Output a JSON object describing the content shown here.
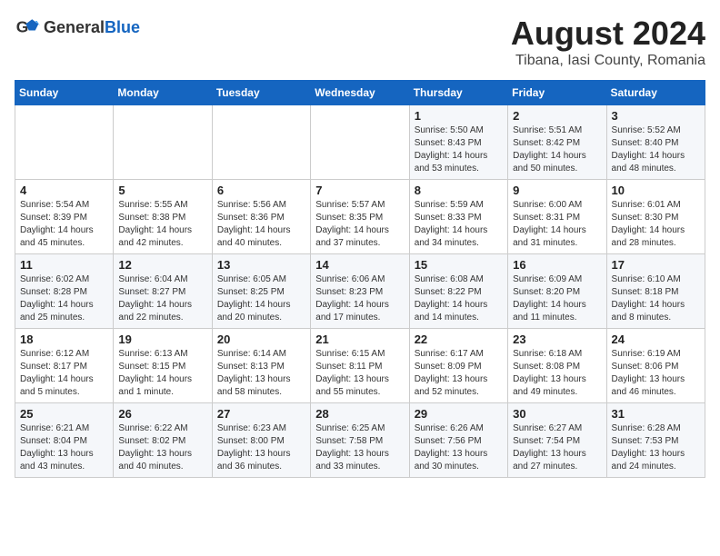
{
  "logo": {
    "text_general": "General",
    "text_blue": "Blue"
  },
  "title": "August 2024",
  "subtitle": "Tibana, Iasi County, Romania",
  "days_of_week": [
    "Sunday",
    "Monday",
    "Tuesday",
    "Wednesday",
    "Thursday",
    "Friday",
    "Saturday"
  ],
  "weeks": [
    [
      {
        "day": "",
        "info": ""
      },
      {
        "day": "",
        "info": ""
      },
      {
        "day": "",
        "info": ""
      },
      {
        "day": "",
        "info": ""
      },
      {
        "day": "1",
        "info": "Sunrise: 5:50 AM\nSunset: 8:43 PM\nDaylight: 14 hours\nand 53 minutes."
      },
      {
        "day": "2",
        "info": "Sunrise: 5:51 AM\nSunset: 8:42 PM\nDaylight: 14 hours\nand 50 minutes."
      },
      {
        "day": "3",
        "info": "Sunrise: 5:52 AM\nSunset: 8:40 PM\nDaylight: 14 hours\nand 48 minutes."
      }
    ],
    [
      {
        "day": "4",
        "info": "Sunrise: 5:54 AM\nSunset: 8:39 PM\nDaylight: 14 hours\nand 45 minutes."
      },
      {
        "day": "5",
        "info": "Sunrise: 5:55 AM\nSunset: 8:38 PM\nDaylight: 14 hours\nand 42 minutes."
      },
      {
        "day": "6",
        "info": "Sunrise: 5:56 AM\nSunset: 8:36 PM\nDaylight: 14 hours\nand 40 minutes."
      },
      {
        "day": "7",
        "info": "Sunrise: 5:57 AM\nSunset: 8:35 PM\nDaylight: 14 hours\nand 37 minutes."
      },
      {
        "day": "8",
        "info": "Sunrise: 5:59 AM\nSunset: 8:33 PM\nDaylight: 14 hours\nand 34 minutes."
      },
      {
        "day": "9",
        "info": "Sunrise: 6:00 AM\nSunset: 8:31 PM\nDaylight: 14 hours\nand 31 minutes."
      },
      {
        "day": "10",
        "info": "Sunrise: 6:01 AM\nSunset: 8:30 PM\nDaylight: 14 hours\nand 28 minutes."
      }
    ],
    [
      {
        "day": "11",
        "info": "Sunrise: 6:02 AM\nSunset: 8:28 PM\nDaylight: 14 hours\nand 25 minutes."
      },
      {
        "day": "12",
        "info": "Sunrise: 6:04 AM\nSunset: 8:27 PM\nDaylight: 14 hours\nand 22 minutes."
      },
      {
        "day": "13",
        "info": "Sunrise: 6:05 AM\nSunset: 8:25 PM\nDaylight: 14 hours\nand 20 minutes."
      },
      {
        "day": "14",
        "info": "Sunrise: 6:06 AM\nSunset: 8:23 PM\nDaylight: 14 hours\nand 17 minutes."
      },
      {
        "day": "15",
        "info": "Sunrise: 6:08 AM\nSunset: 8:22 PM\nDaylight: 14 hours\nand 14 minutes."
      },
      {
        "day": "16",
        "info": "Sunrise: 6:09 AM\nSunset: 8:20 PM\nDaylight: 14 hours\nand 11 minutes."
      },
      {
        "day": "17",
        "info": "Sunrise: 6:10 AM\nSunset: 8:18 PM\nDaylight: 14 hours\nand 8 minutes."
      }
    ],
    [
      {
        "day": "18",
        "info": "Sunrise: 6:12 AM\nSunset: 8:17 PM\nDaylight: 14 hours\nand 5 minutes."
      },
      {
        "day": "19",
        "info": "Sunrise: 6:13 AM\nSunset: 8:15 PM\nDaylight: 14 hours\nand 1 minute."
      },
      {
        "day": "20",
        "info": "Sunrise: 6:14 AM\nSunset: 8:13 PM\nDaylight: 13 hours\nand 58 minutes."
      },
      {
        "day": "21",
        "info": "Sunrise: 6:15 AM\nSunset: 8:11 PM\nDaylight: 13 hours\nand 55 minutes."
      },
      {
        "day": "22",
        "info": "Sunrise: 6:17 AM\nSunset: 8:09 PM\nDaylight: 13 hours\nand 52 minutes."
      },
      {
        "day": "23",
        "info": "Sunrise: 6:18 AM\nSunset: 8:08 PM\nDaylight: 13 hours\nand 49 minutes."
      },
      {
        "day": "24",
        "info": "Sunrise: 6:19 AM\nSunset: 8:06 PM\nDaylight: 13 hours\nand 46 minutes."
      }
    ],
    [
      {
        "day": "25",
        "info": "Sunrise: 6:21 AM\nSunset: 8:04 PM\nDaylight: 13 hours\nand 43 minutes."
      },
      {
        "day": "26",
        "info": "Sunrise: 6:22 AM\nSunset: 8:02 PM\nDaylight: 13 hours\nand 40 minutes."
      },
      {
        "day": "27",
        "info": "Sunrise: 6:23 AM\nSunset: 8:00 PM\nDaylight: 13 hours\nand 36 minutes."
      },
      {
        "day": "28",
        "info": "Sunrise: 6:25 AM\nSunset: 7:58 PM\nDaylight: 13 hours\nand 33 minutes."
      },
      {
        "day": "29",
        "info": "Sunrise: 6:26 AM\nSunset: 7:56 PM\nDaylight: 13 hours\nand 30 minutes."
      },
      {
        "day": "30",
        "info": "Sunrise: 6:27 AM\nSunset: 7:54 PM\nDaylight: 13 hours\nand 27 minutes."
      },
      {
        "day": "31",
        "info": "Sunrise: 6:28 AM\nSunset: 7:53 PM\nDaylight: 13 hours\nand 24 minutes."
      }
    ]
  ]
}
